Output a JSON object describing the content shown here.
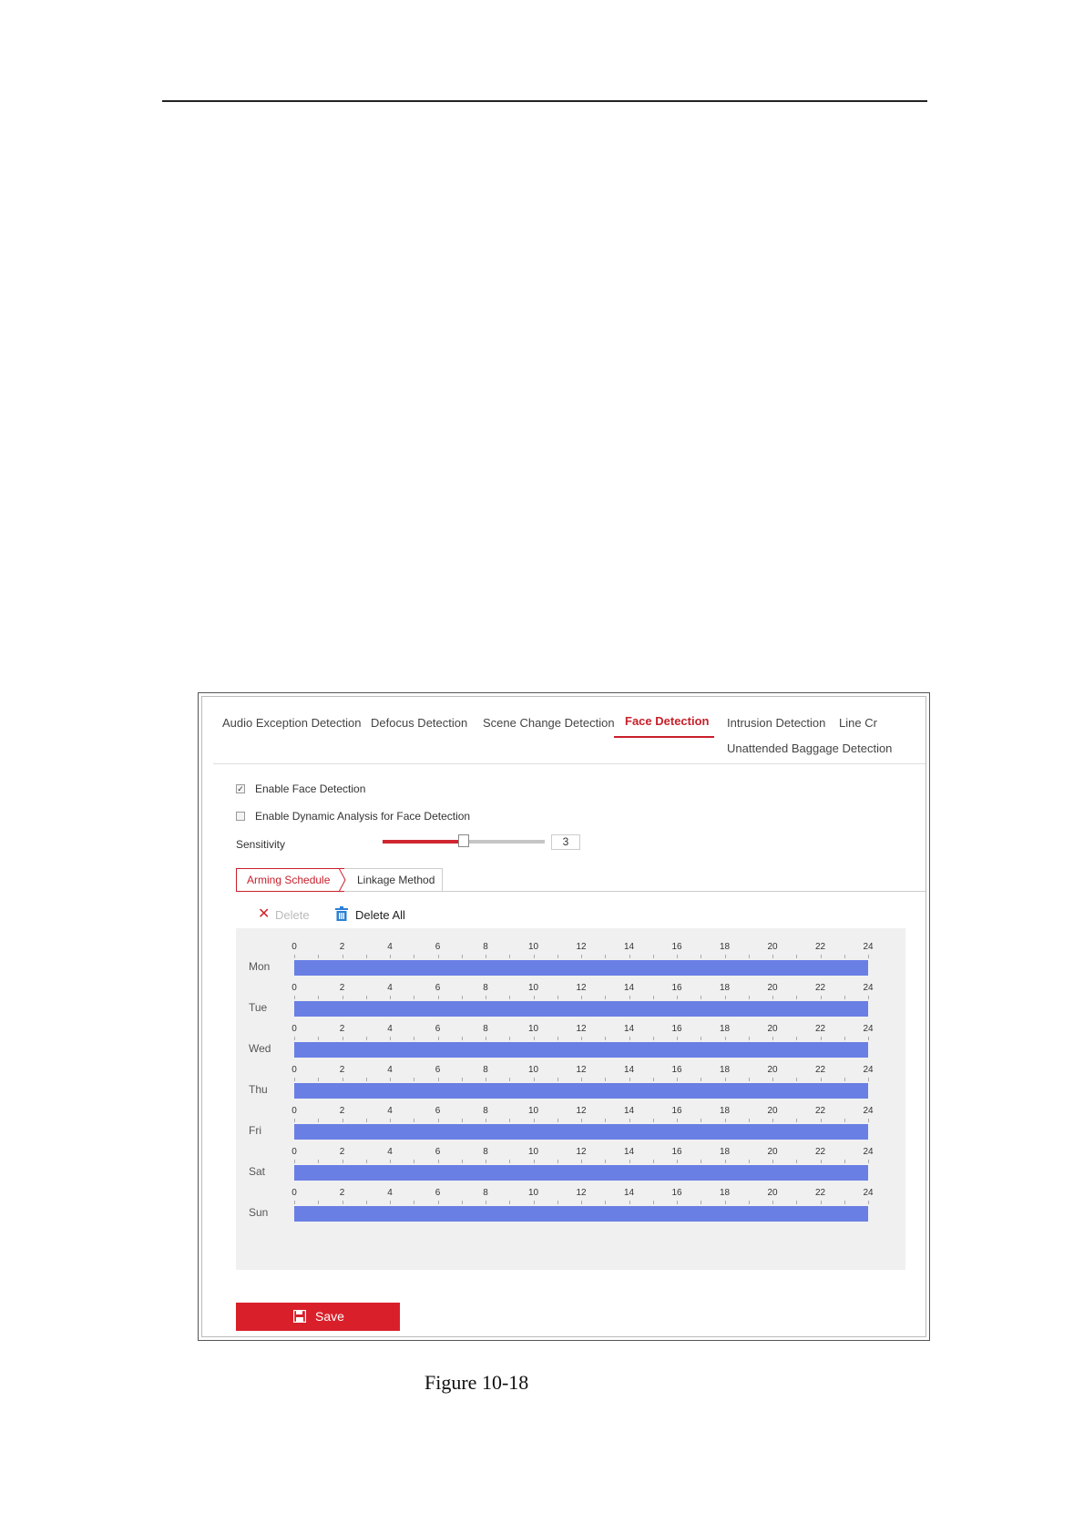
{
  "tabs": [
    {
      "label": "Audio Exception Detection"
    },
    {
      "label": "Defocus Detection"
    },
    {
      "label": "Scene Change Detection"
    },
    {
      "label": "Face Detection",
      "active": true
    },
    {
      "label": "Intrusion Detection"
    },
    {
      "label": "Line Cr"
    },
    {
      "label": "Unattended Baggage Detection"
    }
  ],
  "options": {
    "enable_face_detection": {
      "label": "Enable Face Detection",
      "checked": true
    },
    "enable_dynamic_analysis": {
      "label": "Enable Dynamic Analysis for Face Detection",
      "checked": false
    }
  },
  "sensitivity": {
    "label": "Sensitivity",
    "value": "3",
    "fraction": 0.5
  },
  "subtabs": {
    "arming": "Arming Schedule",
    "linkage": "Linkage Method"
  },
  "toolbar": {
    "delete_label": "Delete",
    "delete_all_label": "Delete All"
  },
  "schedule": {
    "hours": [
      "0",
      "2",
      "4",
      "6",
      "8",
      "10",
      "12",
      "14",
      "16",
      "18",
      "20",
      "22",
      "24"
    ],
    "days": [
      "Mon",
      "Tue",
      "Wed",
      "Thu",
      "Fri",
      "Sat",
      "Sun"
    ],
    "bar_color": "#6a7fe4"
  },
  "save_label": "Save",
  "caption": "Figure 10-18",
  "colors": {
    "accent": "#c8202b",
    "save": "#d9202a"
  }
}
